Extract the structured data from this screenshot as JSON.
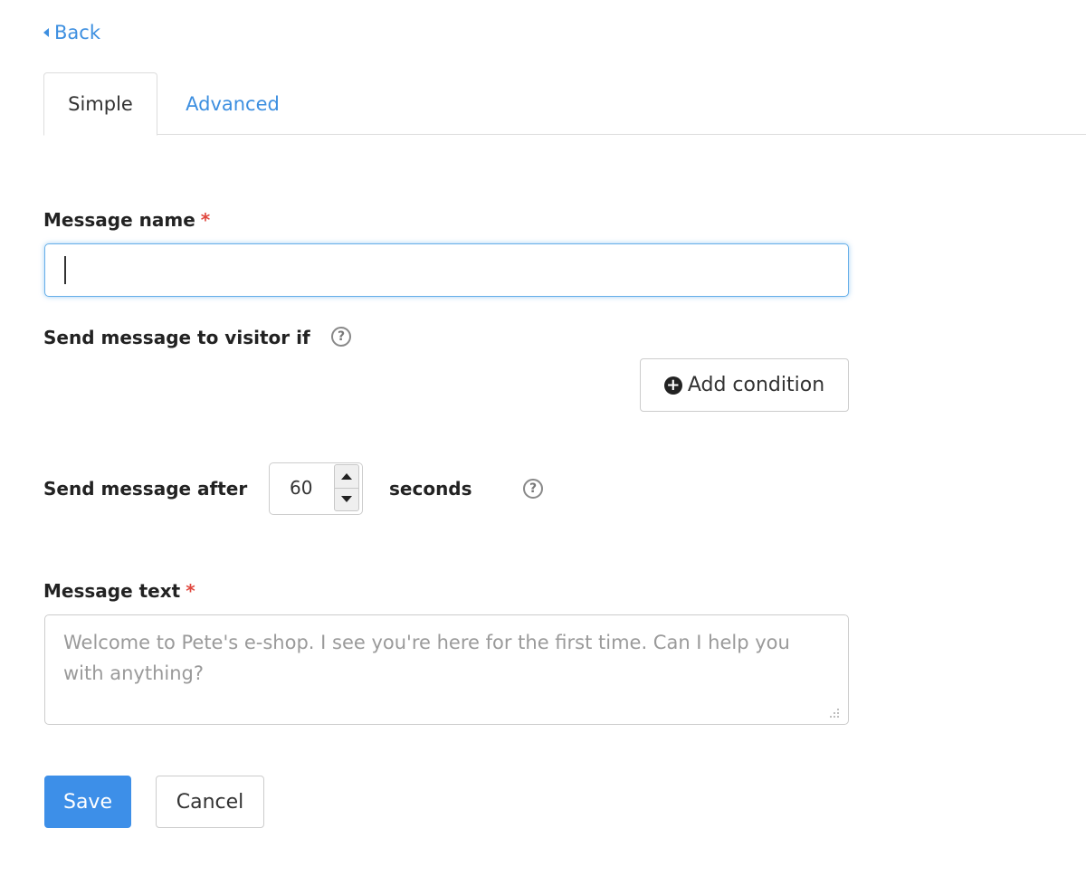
{
  "nav": {
    "back_label": "Back"
  },
  "tabs": [
    {
      "label": "Simple",
      "active": true
    },
    {
      "label": "Advanced",
      "active": false
    }
  ],
  "form": {
    "message_name": {
      "label": "Message name",
      "required_mark": "*",
      "value": ""
    },
    "send_if": {
      "label": "Send message to visitor if",
      "help": "?",
      "add_condition_label": "Add condition"
    },
    "send_after": {
      "label": "Send message after",
      "value": "60",
      "unit_label": "seconds",
      "help": "?"
    },
    "message_text": {
      "label": "Message text",
      "required_mark": "*",
      "placeholder": "Welcome to Pete's e-shop. I see you're here for the first time. Can I help you with anything?"
    }
  },
  "actions": {
    "save_label": "Save",
    "cancel_label": "Cancel"
  },
  "colors": {
    "accent": "#3d8fe8",
    "link": "#3d8fe0",
    "required": "#e0483f",
    "focus_border": "#66afe9"
  }
}
